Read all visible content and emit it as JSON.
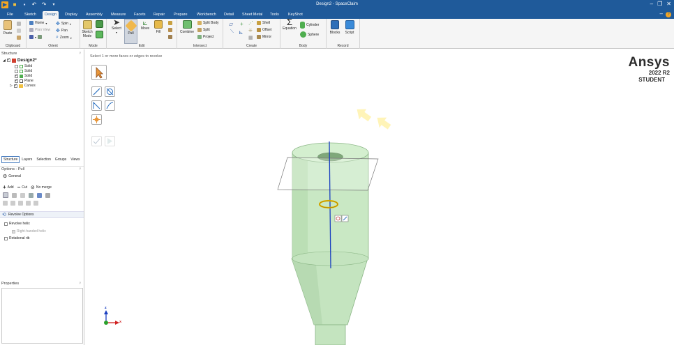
{
  "app": {
    "title": "Design2 - SpaceClaim"
  },
  "window_controls": [
    "–",
    "❐",
    "✕"
  ],
  "menu": {
    "tabs": [
      "File",
      "Sketch",
      "Design",
      "Display",
      "Assembly",
      "Measure",
      "Facets",
      "Repair",
      "Prepare",
      "Workbench",
      "Detail",
      "Sheet Metal",
      "Tools",
      "KeyShot"
    ],
    "active": "Design",
    "minimize_ribbon": "–",
    "help": "?"
  },
  "ribbon": {
    "clipboard": {
      "paste": "Paste",
      "label": "Clipboard"
    },
    "orient": {
      "home": "Home",
      "spin": "Spin",
      "plan_view": "Plan View",
      "pan": "Pan",
      "zoom": "Zoom",
      "label": "Orient"
    },
    "mode": {
      "sketch_mode": "Sketch Mode",
      "label": "Mode"
    },
    "edit": {
      "select": "Select",
      "pull": "Pull",
      "move": "Move",
      "fill": "Fill",
      "label": "Edit"
    },
    "intersect": {
      "combine": "Combine",
      "split_body": "Split Body",
      "split": "Split",
      "project": "Project",
      "label": "Intersect"
    },
    "create": {
      "shell": "Shell",
      "offset": "Offset",
      "mirror": "Mirror",
      "label": "Create"
    },
    "body": {
      "equation": "Equation",
      "cylinder": "Cylinder",
      "sphere": "Sphere",
      "label": "Body"
    },
    "record": {
      "blocks": "Blocks",
      "script": "Script",
      "label": "Record"
    }
  },
  "structure": {
    "header": "Structure",
    "pin": "ᵖ",
    "root": "Design2*",
    "items": [
      "Solid",
      "Solid",
      "Solid",
      "Plane",
      "Curves"
    ]
  },
  "panel_tabs": [
    "Structure",
    "Layers",
    "Selection",
    "Groups",
    "Views"
  ],
  "options": {
    "header": "Options - Pull",
    "general": "General",
    "add": "Add",
    "cut": "Cut",
    "no_merge": "No merge",
    "revolve_section": "Revolve Options",
    "revolve_helix": "Revolve helix",
    "right_handed_helix": "Right-handed helix",
    "rotational_rib": "Rotational rib"
  },
  "properties": {
    "header": "Properties"
  },
  "viewport": {
    "hint": "Select 1 or more faces or edges to revolve",
    "axis_z": "z",
    "axis_x": "x"
  },
  "logo": {
    "brand": "Ansys",
    "version": "2022 R2",
    "edition": "STUDENT"
  },
  "colors": {
    "titlebar": "#1f5a9a",
    "body_green": "#c9e8c4",
    "axis_blue": "#1a3fc0"
  }
}
